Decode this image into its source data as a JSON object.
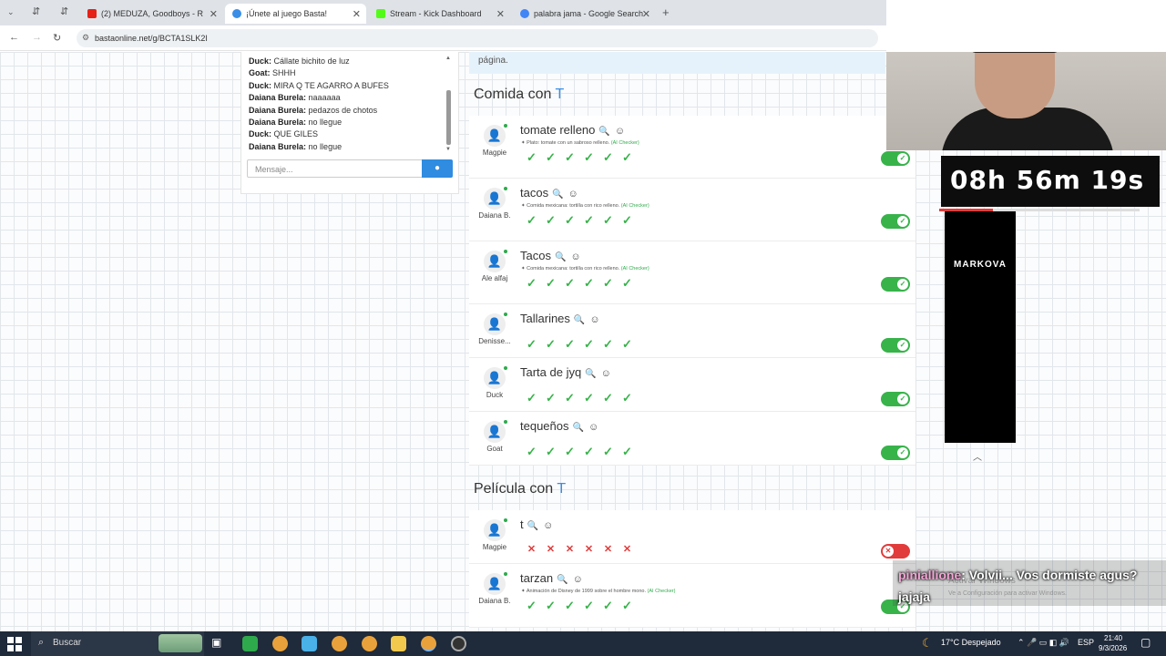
{
  "browser": {
    "tabs": [
      {
        "label": "(2) MEDUZA, Goodboys - R",
        "color": "#e62117"
      },
      {
        "label": "¡Únete al juego Basta!",
        "color": "#3a8ee6",
        "active": true
      },
      {
        "label": "Stream - Kick Dashboard",
        "color": "#53fc18"
      },
      {
        "label": "palabra jama - Google Search",
        "color": "#4285f4"
      }
    ],
    "new_tab": "+",
    "url": "bastaonline.net/g/BCTA1SLK2I"
  },
  "chat": {
    "messages": [
      {
        "user": "Duck:",
        "text": "Cállate bichito de luz"
      },
      {
        "user": "Goat:",
        "text": "SHHH"
      },
      {
        "user": "Duck:",
        "text": "MIRA Q TE AGARRO A BUFES"
      },
      {
        "user": "Daiana Burela:",
        "text": "naaaaaa"
      },
      {
        "user": "Daiana Burela:",
        "text": "pedazos de chotos"
      },
      {
        "user": "Daiana Burela:",
        "text": "no llegue"
      },
      {
        "user": "Duck:",
        "text": "QUE GILES"
      },
      {
        "user": "Daiana Burela:",
        "text": "no llegue"
      }
    ],
    "input_placeholder": "Mensaje..."
  },
  "board": {
    "notice_text": "página.",
    "letter": "T",
    "sections": [
      {
        "title": "Comida con",
        "rows": [
          {
            "player": "Magpie",
            "word": "tomate relleno",
            "hint": "Plato: tomate con un sabroso relleno.",
            "ai": "(AI Checker)",
            "votes": [
              "✓",
              "✓",
              "✓",
              "✓",
              "✓",
              "✓"
            ],
            "valid": true
          },
          {
            "player": "Daiana B.",
            "word": "tacos",
            "hint": "Comida mexicana: tortilla con rico relleno.",
            "ai": "(AI Checker)",
            "votes": [
              "✓",
              "✓",
              "✓",
              "✓",
              "✓",
              "✓"
            ],
            "valid": true
          },
          {
            "player": "Ale alfaj",
            "word": "Tacos",
            "hint": "Comida mexicana: tortilla con rico relleno.",
            "ai": "(AI Checker)",
            "votes": [
              "✓",
              "✓",
              "✓",
              "✓",
              "✓",
              "✓"
            ],
            "valid": true
          },
          {
            "player": "Denisse...",
            "word": "Tallarines",
            "hint": "",
            "ai": "",
            "votes": [
              "✓",
              "✓",
              "✓",
              "✓",
              "✓",
              "✓"
            ],
            "valid": true
          },
          {
            "player": "Duck",
            "word": "Tarta de jyq",
            "hint": "",
            "ai": "",
            "votes": [
              "✓",
              "✓",
              "✓",
              "✓",
              "✓",
              "✓"
            ],
            "valid": true
          },
          {
            "player": "Goat",
            "word": "tequeños",
            "hint": "",
            "ai": "",
            "votes": [
              "✓",
              "✓",
              "✓",
              "✓",
              "✓",
              "✓"
            ],
            "valid": true
          }
        ]
      },
      {
        "title": "Película con",
        "rows": [
          {
            "player": "Magpie",
            "word": "t",
            "hint": "",
            "ai": "",
            "votes": [
              "✕",
              "✕",
              "✕",
              "✕",
              "✕",
              "✕"
            ],
            "valid": false
          },
          {
            "player": "Daiana B.",
            "word": "tarzan",
            "hint": "Animación de Disney de 1999 sobre el hombre mono.",
            "ai": "(AI Checker)",
            "votes": [
              "✓",
              "✓",
              "✓",
              "✓",
              "✓",
              "✓"
            ],
            "valid": true
          }
        ]
      }
    ]
  },
  "overlay": {
    "timer": "08h 56m 19s",
    "timer_progress": 0.27,
    "sponsor": "MARKOVA",
    "chat_user": "piniallione",
    "chat_text": ": Volvii... Vos dormiste agus? jajaja",
    "watermark_title": "Activar Windows",
    "watermark_sub": "Ve a Configuración para activar Windows."
  },
  "taskbar": {
    "search_placeholder": "Buscar",
    "weather": "17°C Despejado",
    "lang": "ESP",
    "time": "21:40",
    "date": "9/3/2026"
  }
}
